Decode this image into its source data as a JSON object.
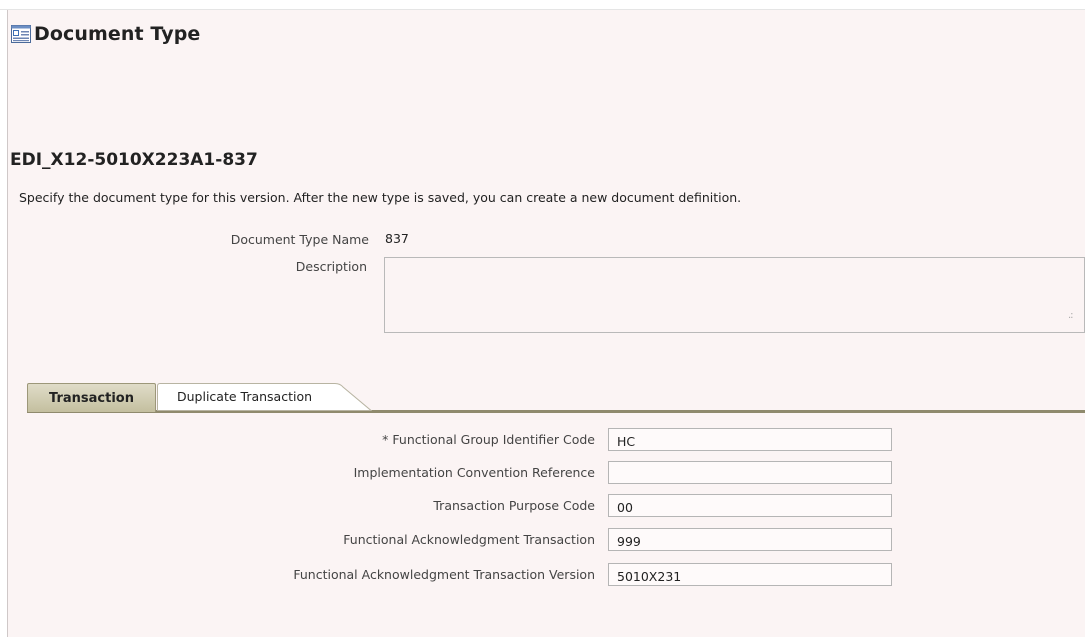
{
  "page": {
    "title": "Document Type"
  },
  "section": {
    "title": "EDI_X12-5010X223A1-837",
    "instructions": "Specify the document type for this version. After the new type is saved, you can create a new document definition."
  },
  "document": {
    "name_label": "Document Type Name",
    "name_value": "837",
    "description_label": "Description",
    "description_value": ""
  },
  "tabs": [
    {
      "label": "Transaction",
      "selected": true
    },
    {
      "label": "Duplicate Transaction",
      "selected": false
    }
  ],
  "transaction": {
    "required_marker": "*",
    "fields": [
      {
        "label": "Functional Group Identifier Code",
        "value": "HC",
        "required": true
      },
      {
        "label": "Implementation Convention Reference",
        "value": ""
      },
      {
        "label": "Transaction Purpose Code",
        "value": "00"
      },
      {
        "label": "Functional Acknowledgment Transaction",
        "value": "999"
      },
      {
        "label": "Functional Acknowledgment Transaction Version",
        "value": "5010X231"
      }
    ]
  },
  "colors": {
    "panel_background": "#fbf4f4",
    "tab_active": "#c4bf9f",
    "tab_rule": "#8f8a6d"
  },
  "icons": {
    "header": "document-list-icon"
  }
}
